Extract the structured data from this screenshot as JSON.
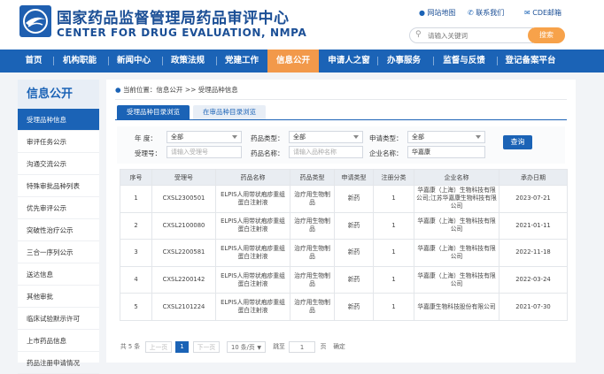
{
  "header": {
    "title_cn": "国家药品监督管理局药品审评中心",
    "title_en": "CENTER FOR DRUG EVALUATION, NMPA",
    "links": [
      "网站地图",
      "联系我们",
      "CDE邮箱"
    ],
    "search_placeholder": "请输入关键词",
    "search_button": "搜索"
  },
  "nav": {
    "items": [
      "首页",
      "机构职能",
      "新闻中心",
      "政策法规",
      "党建工作",
      "信息公开",
      "申请人之窗",
      "办事服务",
      "监督与反馈",
      "登记备案平台"
    ],
    "active_index": 5
  },
  "sidebar": {
    "title": "信息公开",
    "items": [
      "受理品种信息",
      "审评任务公示",
      "沟通交流公示",
      "特殊审批品种列表",
      "优先审评公示",
      "突破性治疗公示",
      "三合一序列公示",
      "送达信息",
      "其他审批",
      "临床试验默示许可",
      "上市药品信息",
      "药品注册申请情况"
    ],
    "active_index": 0
  },
  "main": {
    "breadcrumb": "当前位置：信息公开 >> 受理品种信息",
    "tabs": [
      "受理品种目录浏览",
      "在审品种目录浏览"
    ],
    "active_tab": 0,
    "filters": {
      "year_label": "年  度：",
      "year_value": "全部",
      "drug_type_label": "药品类型：",
      "drug_type_value": "全部",
      "apply_type_label": "申请类型：",
      "apply_type_value": "全部",
      "accept_no_label": "受理号：",
      "accept_no_placeholder": "请输入受理号",
      "drug_name_label": "药品名称：",
      "drug_name_placeholder": "请输入品种名称",
      "company_label": "企业名称：",
      "company_value": "华嘉康",
      "query_button": "查询"
    },
    "table": {
      "headers": [
        "序号",
        "受理号",
        "药品名称",
        "药品类型",
        "申请类型",
        "注册分类",
        "企业名称",
        "承办日期"
      ],
      "rows": [
        [
          "1",
          "CXSL2300501",
          "ELPIS人用带状疱疹重组蛋白注射液",
          "治疗用生物制品",
          "新药",
          "1",
          "华嘉康（上海）生物科技有限公司;江苏华嘉康生物科技有限公司",
          "2023-07-21"
        ],
        [
          "2",
          "CXSL2100080",
          "ELPIS人用带状疱疹重组蛋白注射液",
          "治疗用生物制品",
          "新药",
          "1",
          "华嘉康（上海）生物科技有限公司",
          "2021-01-11"
        ],
        [
          "3",
          "CXSL2200581",
          "ELPIS人用带状疱疹重组蛋白注射液",
          "治疗用生物制品",
          "新药",
          "1",
          "华嘉康（上海）生物科技有限公司",
          "2022-11-18"
        ],
        [
          "4",
          "CXSL2200142",
          "ELPIS人用带状疱疹重组蛋白注射液",
          "治疗用生物制品",
          "新药",
          "1",
          "华嘉康（上海）生物科技有限公司",
          "2022-03-24"
        ],
        [
          "5",
          "CXSL2101224",
          "ELPIS人用带状疱疹重组蛋白注射液",
          "治疗用生物制品",
          "新药",
          "1",
          "华嘉康生物科技股份有限公司",
          "2021-07-30"
        ]
      ]
    },
    "pager": {
      "total": "共 5 条",
      "prev": "上一页",
      "current": "1",
      "next": "下一页",
      "page_size": "10 条/页",
      "goto_prefix": "跳至",
      "goto_value": "1",
      "goto_suffix": "页",
      "goto_button": "确定"
    }
  },
  "colors": {
    "primary": "#1b63b6",
    "accent": "#f2994a",
    "search_button": "#f7a24a"
  }
}
